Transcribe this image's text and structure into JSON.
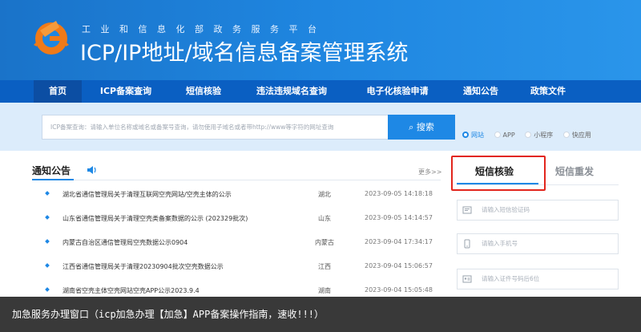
{
  "header": {
    "subtitle": "工业和信息化部政务服务平台",
    "title": "ICP/IP地址/域名信息备案管理系统"
  },
  "nav": {
    "items": [
      {
        "label": "首页",
        "active": true
      },
      {
        "label": "ICP备案查询"
      },
      {
        "label": "短信核验"
      },
      {
        "label": "违法违规域名查询"
      },
      {
        "label": "电子化核验申请"
      },
      {
        "label": "通知公告"
      },
      {
        "label": "政策文件"
      }
    ]
  },
  "search": {
    "placeholder": "ICP备案查询：请输入单位名称或域名或备案号查询，请勿使用子域名或者带http://www等字符的网址查询",
    "button_label": "搜索",
    "options": [
      {
        "label": "网站",
        "selected": true
      },
      {
        "label": "APP"
      },
      {
        "label": "小程序"
      },
      {
        "label": "快应用"
      }
    ]
  },
  "notice": {
    "title": "通知公告",
    "more": "更多>>",
    "rows": [
      {
        "title": "湖北省通信管理局关于清理互联网空壳网站/空壳主体的公示",
        "province": "湖北",
        "date": "2023-09-05 14:18:18"
      },
      {
        "title": "山东省通信管理局关于清理空壳类备案数据的公示 (202329批次)",
        "province": "山东",
        "date": "2023-09-05 14:14:57"
      },
      {
        "title": "内蒙古自治区通信管理局空壳数据公示0904",
        "province": "内蒙古",
        "date": "2023-09-04 17:34:17"
      },
      {
        "title": "江西省通信管理局关于清理20230904批次空壳数据公示",
        "province": "江西",
        "date": "2023-09-04 15:06:57"
      },
      {
        "title": "湖南省空壳主体空壳网站空壳APP公示2023.9.4",
        "province": "湖南",
        "date": "2023-09-04 15:05:48"
      }
    ]
  },
  "sms": {
    "tab_active": "短信核验",
    "tab_other": "短信重发",
    "fields": [
      {
        "placeholder": "请输入短信验证码",
        "icon": "sms-icon"
      },
      {
        "placeholder": "请输入手机号",
        "icon": "phone-icon"
      },
      {
        "placeholder": "请输入证件号码后6位",
        "icon": "id-card-icon"
      }
    ]
  },
  "caption": "加急服务办理窗口（icp加急办理【加急】APP备案操作指南，速收!!!）",
  "colors": {
    "header_blue": "#1f86e0",
    "nav_blue": "#0a5fc2",
    "accent": "#1e88e5",
    "highlight_red": "#e2261d"
  }
}
